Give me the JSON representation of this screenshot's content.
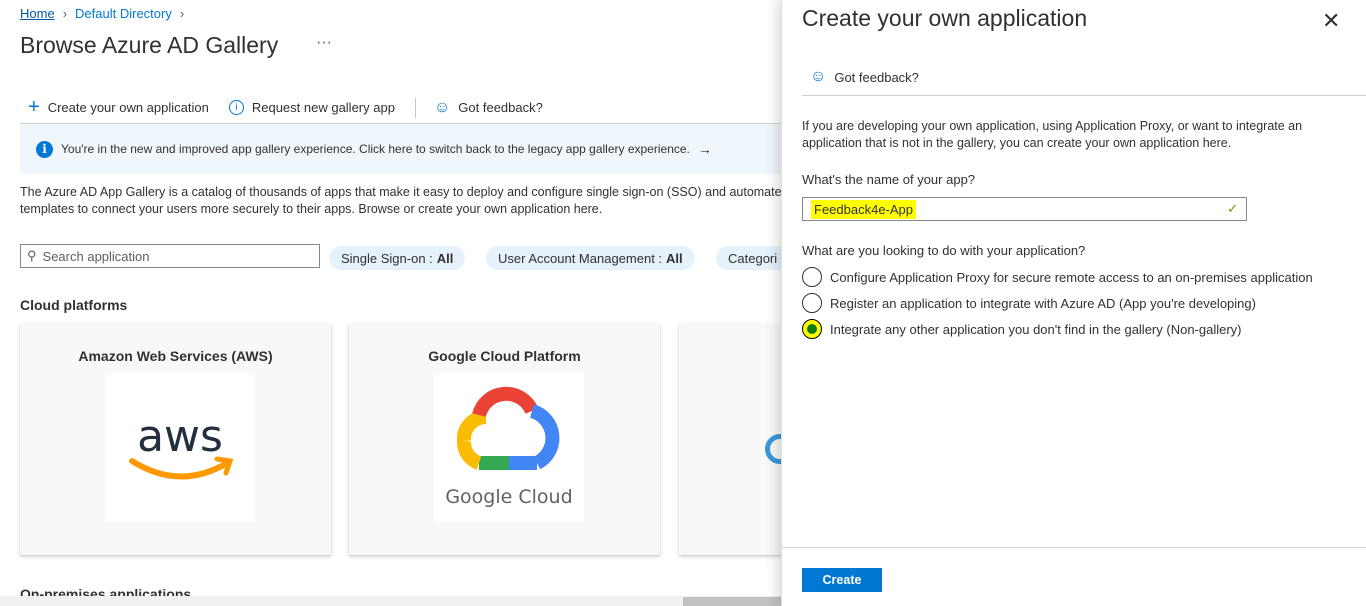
{
  "breadcrumb": {
    "home": "Home",
    "dir": "Default Directory"
  },
  "page": {
    "title": "Browse Azure AD Gallery",
    "more": "···"
  },
  "toolbar": {
    "create": "Create your own application",
    "request": "Request new gallery app",
    "feedback": "Got feedback?"
  },
  "infobar": {
    "text": "You're in the new and improved app gallery experience. Click here to switch back to the legacy app gallery experience.",
    "arrow": "→"
  },
  "description": "The Azure AD App Gallery is a catalog of thousands of apps that make it easy to deploy and configure single sign-on (SSO) and automated user provisioning. Use app templates to connect your users more securely to their apps. Browse or create your own application here.",
  "description2": "templates to connect your users more securely to their apps. Browse or create your own application here.",
  "search": {
    "placeholder": "Search application"
  },
  "filters": [
    {
      "label": "Single Sign-on :",
      "value": "All"
    },
    {
      "label": "User Account Management :",
      "value": "All"
    },
    {
      "label": "Categori",
      "value": ""
    }
  ],
  "sections": {
    "cloud": "Cloud platforms",
    "onprem": "On-premises applications"
  },
  "cards": [
    {
      "title": "Amazon Web Services (AWS)",
      "logo_text": "aws"
    },
    {
      "title": "Google Cloud Platform",
      "logo_text": "Google Cloud"
    }
  ],
  "panel": {
    "title": "Create your own application",
    "feedback": "Got feedback?",
    "description": "If you are developing your own application, using Application Proxy, or want to integrate an application that is not in the gallery, you can create your own application here.",
    "name_label": "What's the name of your app?",
    "name_value": "Feedback4e-App",
    "purpose_label": "What are you looking to do with your application?",
    "options": [
      {
        "label": "Configure Application Proxy for secure remote access to an on-premises application",
        "selected": false
      },
      {
        "label": "Register an application to integrate with Azure AD (App you're developing)",
        "selected": false
      },
      {
        "label": "Integrate any other application you don't find in the gallery (Non-gallery)",
        "selected": true
      }
    ],
    "create": "Create"
  },
  "colors": {
    "accent": "#0078d4",
    "highlight": "#ffff00",
    "success": "#57a300"
  }
}
